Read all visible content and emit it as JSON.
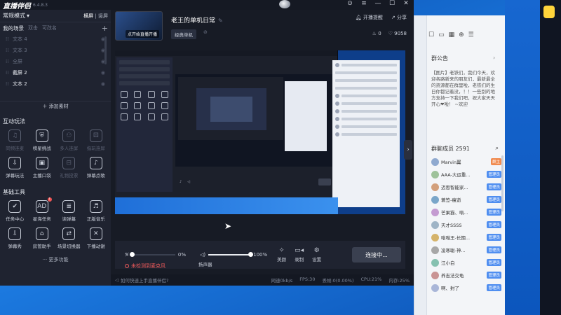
{
  "app": {
    "logo_text": "直播伴侣",
    "version": "6.4.8.3",
    "mode_label": "常规模式",
    "orientation_landscape": "横屏",
    "orientation_portrait": "竖屏",
    "scene_header": "我的场景",
    "scene_double": "双击",
    "scene_addable": "可改名",
    "scenes": [
      {
        "label": "文本 4",
        "active": false
      },
      {
        "label": "文本 3",
        "active": false
      },
      {
        "label": "全屏",
        "active": false
      },
      {
        "label": "截屏 2",
        "active": true
      },
      {
        "label": "文本 2",
        "active": true
      }
    ],
    "add_source": "＋ 添加素材",
    "interactive_title": "互动玩法",
    "interactive_tools": [
      {
        "label": "同频连麦",
        "dim": true,
        "icon": "mic-icon"
      },
      {
        "label": "榜星挑战",
        "dim": false,
        "icon": "shield-icon"
      },
      {
        "label": "多人连屏",
        "dim": true,
        "icon": "people-icon"
      },
      {
        "label": "指玩连屏",
        "dim": true,
        "icon": "gamepad-icon"
      },
      {
        "label": "弹幕玩法",
        "dim": false,
        "icon": "download-icon"
      },
      {
        "label": "主播口袋",
        "dim": false,
        "icon": "pocket-icon"
      },
      {
        "label": "礼物投票",
        "dim": true,
        "icon": "vote-icon"
      },
      {
        "label": "弹幕点歌",
        "dim": false,
        "icon": "music-icon"
      }
    ],
    "basic_title": "基础工具",
    "basic_tools": [
      {
        "label": "任务中心",
        "icon": "task-icon",
        "badge": ""
      },
      {
        "label": "星海任务",
        "icon": "ad-icon",
        "badge": "!"
      },
      {
        "label": "读弹幕",
        "icon": "read-icon",
        "badge": ""
      },
      {
        "label": "正版音乐",
        "icon": "music-note-icon",
        "badge": ""
      },
      {
        "label": "弹幕秀",
        "icon": "show-icon",
        "badge": ""
      },
      {
        "label": "房管助手",
        "icon": "house-icon",
        "badge": ""
      },
      {
        "label": "场景切换器",
        "icon": "switch-icon",
        "badge": ""
      },
      {
        "label": "下播动谢",
        "icon": "thanks-icon",
        "badge": ""
      }
    ],
    "more_features": "··· 更多功能"
  },
  "room": {
    "title": "老王的单机日常",
    "thumb_label": "点开始直播开播",
    "tag": "经典单机",
    "remind": "开播提醒",
    "share": "分享",
    "likes": "0",
    "hearts": "9058"
  },
  "controls": {
    "mic_level": "0%",
    "speaker_level": "100%",
    "speaker_label": "扬声器",
    "speaker_percent": 100,
    "mic_percent": 0,
    "beauty": "美颜",
    "record": "录制",
    "settings": "设置",
    "connect": "连接中...",
    "mic_warning": "未检测到麦克风"
  },
  "status": {
    "help": "如何快速上手直播伴侣?",
    "lost_frames": "网速0kb/s",
    "fps": "FPS:30",
    "lost": "丢帧:0(0.00%)",
    "cpu": "CPU:21%",
    "memory": "内存:25%"
  },
  "chat": {
    "announce_title": "群公告",
    "announce_text": "【图片】老铁们，我们今天，欢迎各路新来的朋友们，最新最全的资源都在群里啦，老铁们的生日你都记着没，！！一些别的地方支持一下我们吧，祝大家天天开心❤啦！ ~欢迎",
    "members_title": "群聊成员 2591",
    "members": [
      {
        "name": "Marvin翼",
        "tag": "群主",
        "owner": true
      },
      {
        "name": "AAA-大运重...",
        "tag": "管理员",
        "owner": false
      },
      {
        "name": "迈思智能家...",
        "tag": "管理员",
        "owner": false
      },
      {
        "name": "蓑笠-瘦逝",
        "tag": "管理员",
        "owner": false
      },
      {
        "name": "芒果猫、嗡...",
        "tag": "管理员",
        "owner": false
      },
      {
        "name": "天才SSSS",
        "tag": "管理员",
        "owner": false
      },
      {
        "name": "嗡嗡王-长期...",
        "tag": "管理员",
        "owner": false
      },
      {
        "name": "凌寒聪-神...",
        "tag": "管理员",
        "owner": false
      },
      {
        "name": "江小白",
        "tag": "管理员",
        "owner": false
      },
      {
        "name": "养志法交龟",
        "tag": "管理员",
        "owner": false
      },
      {
        "name": "啊、射了",
        "tag": "管理员",
        "owner": false
      }
    ]
  }
}
